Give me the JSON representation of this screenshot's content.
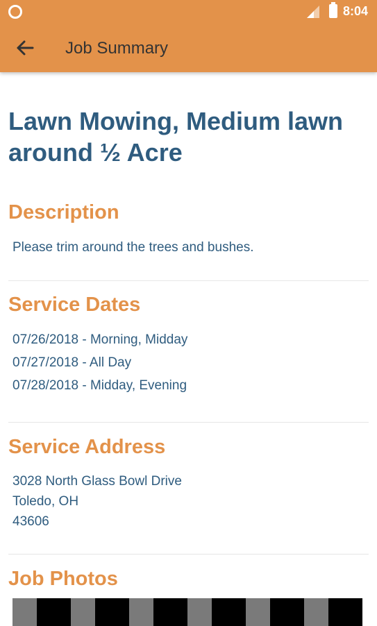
{
  "status_bar": {
    "time": "8:04"
  },
  "app_bar": {
    "title": "Job Summary",
    "back_icon": "arrow-left-icon"
  },
  "job": {
    "title": "Lawn Mowing, Medium lawn around ½ Acre"
  },
  "description": {
    "heading": "Description",
    "text": "Please trim around the trees and bushes."
  },
  "service_dates": {
    "heading": "Service Dates",
    "items": [
      "07/26/2018 - Morning, Midday",
      "07/27/2018 - All Day",
      "07/28/2018 - Midday, Evening"
    ]
  },
  "service_address": {
    "heading": "Service Address",
    "lines": [
      "3028 North Glass Bowl Drive",
      "Toledo, OH",
      "43606"
    ]
  },
  "job_photos": {
    "heading": "Job Photos"
  },
  "colors": {
    "accent": "#E3924A",
    "title_text": "#2F5C7F"
  }
}
